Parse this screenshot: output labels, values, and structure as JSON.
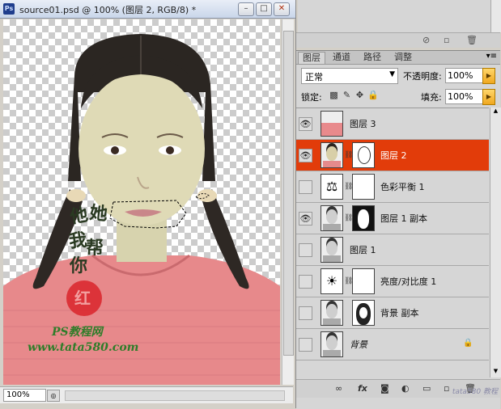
{
  "document": {
    "app_badge": "Ps",
    "title": "source01.psd @ 100% (图层 2, RGB/8) *",
    "zoom": "100%"
  },
  "canvas_watermark": {
    "calligraphy": "他她我帮你",
    "seal": "红",
    "site_name": "PS教程网",
    "site_url": "www.tata580.com"
  },
  "panel": {
    "tabs": [
      "图层",
      "通道",
      "路径",
      "调整"
    ],
    "active_tab": 0,
    "blend_mode": "正常",
    "opacity_label": "不透明度:",
    "opacity_value": "100%",
    "lock_label": "锁定:",
    "fill_label": "填充:",
    "fill_value": "100%"
  },
  "layers": [
    {
      "name": "图层 3",
      "visible": true,
      "selected": false,
      "thumb": "pink",
      "mask": "none",
      "link": false,
      "locked": false
    },
    {
      "name": "图层 2",
      "visible": true,
      "selected": true,
      "thumb": "photo",
      "mask": "silhouette-white",
      "link": true,
      "locked": false
    },
    {
      "name": "色彩平衡 1",
      "visible": false,
      "selected": false,
      "thumb": "balance",
      "mask": "white",
      "link": true,
      "locked": false
    },
    {
      "name": "图层 1 副本",
      "visible": true,
      "selected": false,
      "thumb": "photo-gray",
      "mask": "silhouette-black-bg",
      "link": true,
      "locked": false
    },
    {
      "name": "图层 1",
      "visible": false,
      "selected": false,
      "thumb": "photo-gray",
      "mask": "none",
      "link": false,
      "locked": false
    },
    {
      "name": "亮度/对比度 1",
      "visible": false,
      "selected": false,
      "thumb": "brightness",
      "mask": "white",
      "link": true,
      "locked": false
    },
    {
      "name": "背景 副本",
      "visible": false,
      "selected": false,
      "thumb": "photo-gray",
      "mask": "silhouette-dark",
      "link": false,
      "locked": false
    },
    {
      "name": "背景",
      "visible": false,
      "selected": false,
      "thumb": "photo-gray",
      "mask": "none",
      "link": false,
      "locked": true,
      "italic": true
    }
  ],
  "corner_watermark": "tata580 教程",
  "colors": {
    "selected_layer": "#e23c0a",
    "panel_bg": "#d6d6d6",
    "window_bg": "#d4d0c8"
  }
}
